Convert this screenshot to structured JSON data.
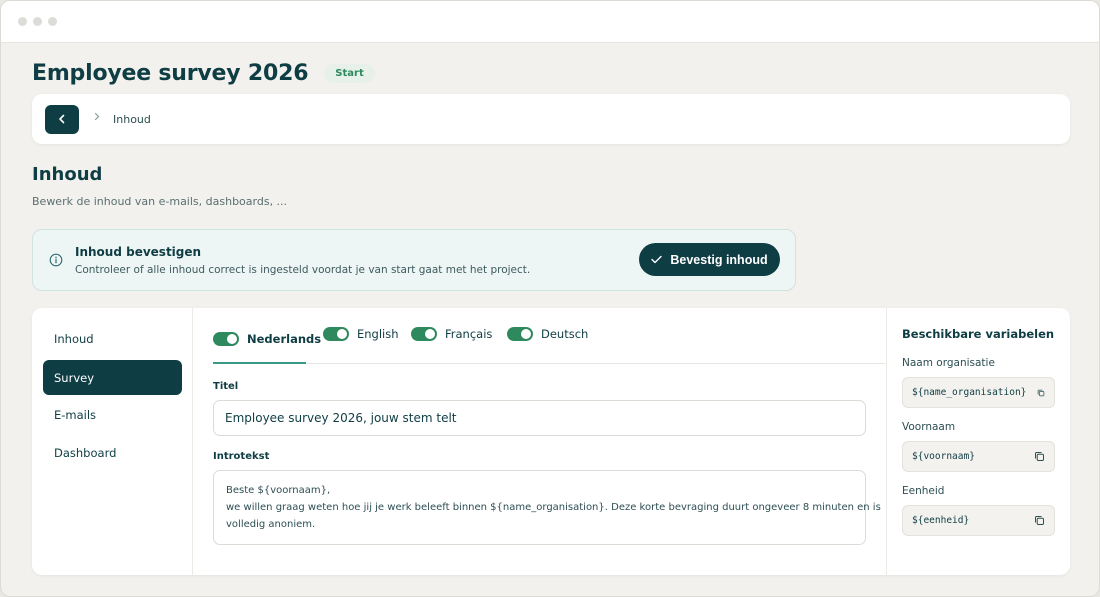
{
  "page": {
    "title": "Employee survey 2026",
    "badge": "Start"
  },
  "breadcrumb": {
    "current": "Inhoud"
  },
  "section": {
    "title": "Inhoud",
    "subtitle": "Bewerk de inhoud van e-mails, dashboards, ..."
  },
  "alert": {
    "title": "Inhoud bevestigen",
    "description": "Controleer of alle inhoud correct is ingesteld voordat je van start gaat met het project.",
    "button_label": "Bevestig inhoud"
  },
  "sidenav": {
    "items": [
      {
        "label": "Inhoud",
        "active": false
      },
      {
        "label": "Survey",
        "active": true
      },
      {
        "label": "E-mails",
        "active": false
      },
      {
        "label": "Dashboard",
        "active": false
      }
    ]
  },
  "languages": [
    {
      "label": "Nederlands",
      "enabled": true,
      "active": true
    },
    {
      "label": "English",
      "enabled": true,
      "active": false
    },
    {
      "label": "Français",
      "enabled": true,
      "active": false
    },
    {
      "label": "Deutsch",
      "enabled": true,
      "active": false
    }
  ],
  "form": {
    "title_label": "Titel",
    "title_value": "Employee survey 2026, jouw stem telt",
    "intro_label": "Introtekst",
    "intro_lines": [
      "Beste ${voornaam},",
      "we willen graag weten hoe jij je werk beleeft binnen ${name_organisation}. Deze korte bevraging duurt ongeveer 8 minuten en is",
      "volledig anoniem."
    ]
  },
  "variables": {
    "title": "Beschikbare variabelen",
    "items": [
      {
        "label": "Naam organisatie",
        "code": "${name_organisation}"
      },
      {
        "label": "Voornaam",
        "code": "${voornaam}"
      },
      {
        "label": "Eenheid",
        "code": "${eenheid}"
      }
    ]
  },
  "colors": {
    "primary": "#0f3d44",
    "accent": "#2e8a5e",
    "background": "#f2f1ed"
  }
}
